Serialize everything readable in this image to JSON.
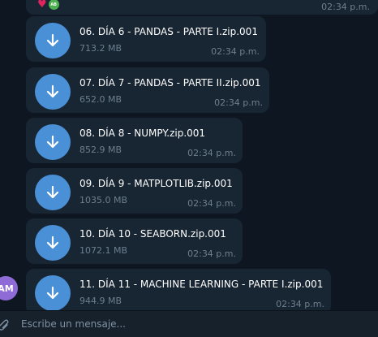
{
  "top_message": {
    "time": "02:34 p.m.",
    "reaction_avatar_initials": "AB"
  },
  "messages": [
    {
      "file_name": "06. DÍA 6 - PANDAS - PARTE I.zip.001",
      "size": "713.2 MB",
      "time": "02:34 p.m."
    },
    {
      "file_name": "07. DÍA 7 - PANDAS - PARTE II.zip.001",
      "size": "652.0 MB",
      "time": "02:34 p.m."
    },
    {
      "file_name": "08. DÍA 8 - NUMPY.zip.001",
      "size": "852.9 MB",
      "time": "02:34 p.m."
    },
    {
      "file_name": "09. DÍA 9 - MATPLOTLIB.zip.001",
      "size": "1035.0 MB",
      "time": "02:34 p.m."
    },
    {
      "file_name": "10. DÍA 10 - SEABORN.zip.001",
      "size": "1072.1 MB",
      "time": "02:34 p.m."
    },
    {
      "file_name": "11. DÍA 11 - MACHINE LEARNING - PARTE I.zip.001",
      "size": "944.9 MB",
      "time": "02:34 p.m."
    }
  ],
  "sender_avatar": {
    "initials": "AM"
  },
  "composer": {
    "placeholder": "Escribe un mensaje..."
  },
  "colors": {
    "background": "#0e1621",
    "bubble": "#182533",
    "download_button": "#4a90d6",
    "muted_text": "#6d7f8f",
    "composer_bg": "#17212b",
    "avatar": "#8e6bd6"
  }
}
